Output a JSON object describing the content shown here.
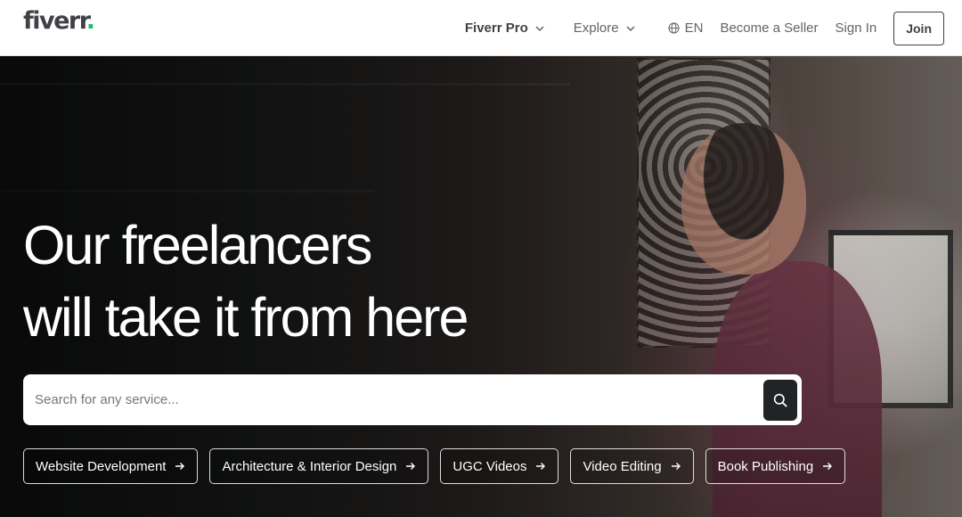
{
  "header": {
    "logo_text": "fiverr",
    "logo_dot": ".",
    "nav": {
      "fiverr_pro": "Fiverr Pro",
      "explore": "Explore",
      "language": "EN",
      "become_seller": "Become a Seller",
      "sign_in": "Sign In",
      "join": "Join"
    }
  },
  "hero": {
    "headline_line1": "Our freelancers",
    "headline_line2": "will take it from here",
    "search": {
      "placeholder": "Search for any service...",
      "value": ""
    },
    "chips": [
      "Website Development",
      "Architecture & Interior Design",
      "UGC Videos",
      "Video Editing",
      "Book Publishing"
    ]
  },
  "colors": {
    "brand_green": "#1dbf73",
    "text_dark": "#404145",
    "text_gray": "#62646a",
    "search_button": "#222325"
  },
  "icons": {
    "chevron": "chevron-down-icon",
    "language": "globe-icon",
    "search": "search-icon",
    "chip_arrow": "arrow-right-icon"
  }
}
